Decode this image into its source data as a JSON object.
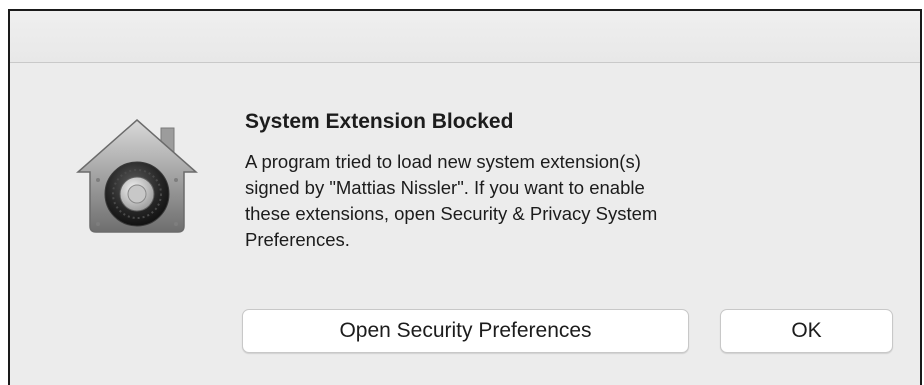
{
  "dialog": {
    "icon": "security-lock-house-icon",
    "title": "System Extension Blocked",
    "message_lines": [
      "A program tried to load new system extension(s)",
      "signed by \"Mattias Nissler\".  If you want to enable",
      "these extensions, open Security & Privacy System",
      "Preferences."
    ],
    "buttons": {
      "open_security_label": "Open Security Preferences",
      "ok_label": "OK"
    }
  },
  "colors": {
    "window_bg": "#ececec",
    "button_bg": "#ffffff",
    "text": "#1c1c1c"
  }
}
